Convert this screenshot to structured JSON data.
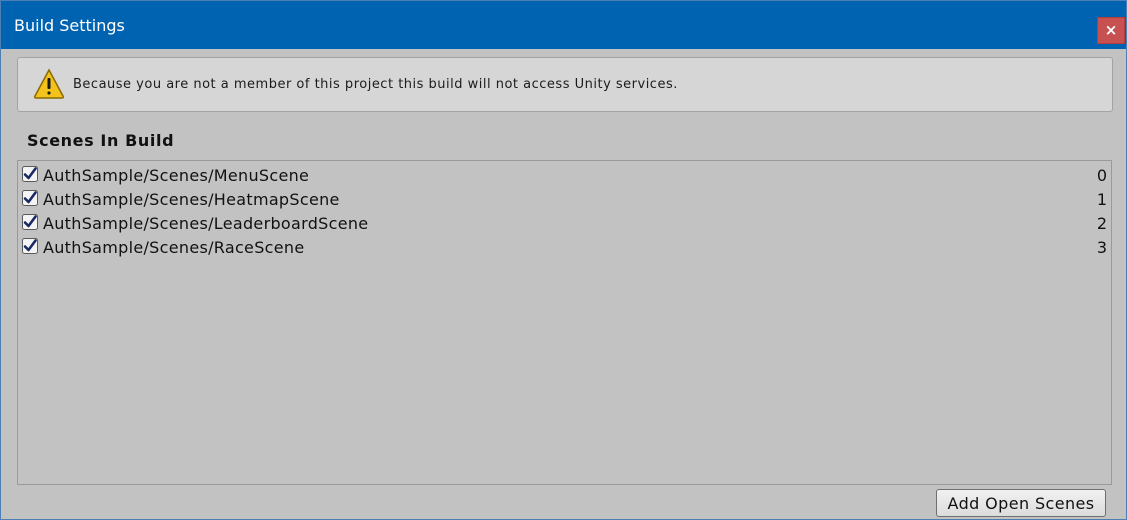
{
  "window": {
    "title": "Build Settings",
    "close_glyph": "×",
    "titlebar_color": "#0063b1",
    "close_color": "#c75050"
  },
  "warning": {
    "icon": "warning-triangle-icon",
    "text": "Because you are not a member of this project this build will not access Unity services."
  },
  "scenes": {
    "title": "Scenes In Build",
    "items": [
      {
        "name": "AuthSample/Scenes/MenuScene",
        "index": "0",
        "checked": true
      },
      {
        "name": "AuthSample/Scenes/HeatmapScene",
        "index": "1",
        "checked": true
      },
      {
        "name": "AuthSample/Scenes/LeaderboardScene",
        "index": "2",
        "checked": true
      },
      {
        "name": "AuthSample/Scenes/RaceScene",
        "index": "3",
        "checked": true
      }
    ]
  },
  "buttons": {
    "add_open_scenes": "Add Open Scenes"
  }
}
